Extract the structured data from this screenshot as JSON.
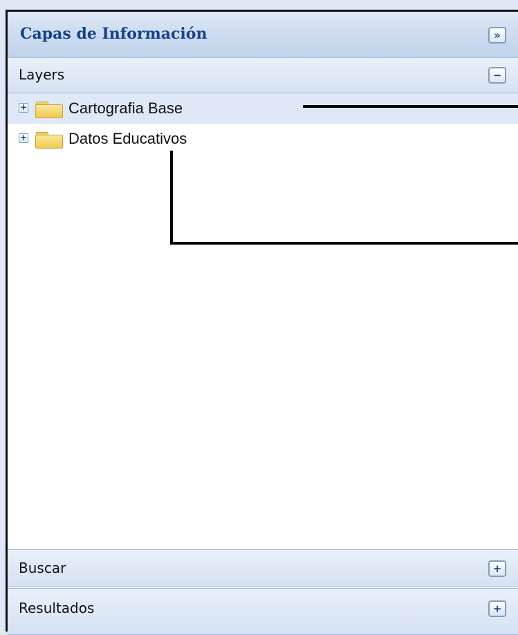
{
  "panel": {
    "title": "Capas de Información",
    "collapse_symbol": "»"
  },
  "layers": {
    "label": "Layers",
    "toggle_symbol": "−",
    "items": [
      {
        "label": "Cartografia Base",
        "expander": "+",
        "icon": "folder-icon",
        "selected": true
      },
      {
        "label": "Datos Educativos",
        "expander": "+",
        "icon": "folder-icon",
        "selected": false
      }
    ]
  },
  "buscar": {
    "label": "Buscar",
    "toggle_symbol": "+"
  },
  "resultados": {
    "label": "Resultados",
    "toggle_symbol": "+"
  },
  "colors": {
    "title_text": "#15428b",
    "header_border": "#99bbe8",
    "frame_border": "#111111"
  }
}
